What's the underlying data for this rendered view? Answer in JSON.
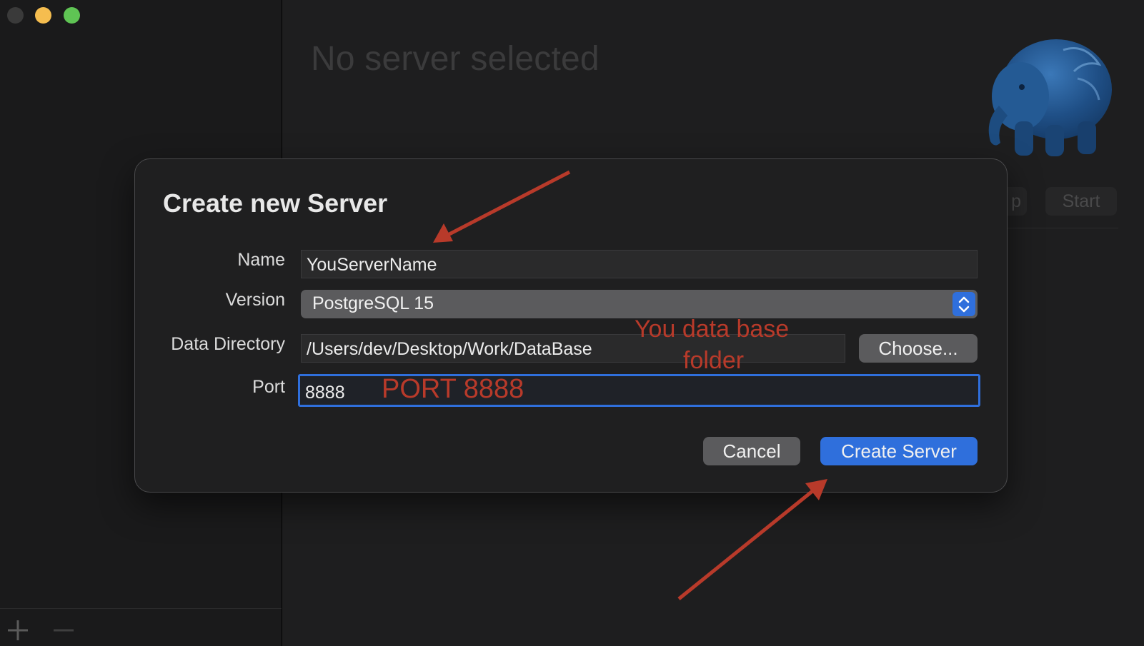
{
  "colors": {
    "accent": "#2f6fdc",
    "annotation": "#b83a2a",
    "close": "#3a3a3a",
    "minimize": "#f5bd4f",
    "zoom": "#5fc454"
  },
  "main": {
    "title": "No server selected",
    "start_label": "Start",
    "clipped_label": "p"
  },
  "dialog": {
    "title": "Create new Server",
    "name_label": "Name",
    "name_value": "YouServerName",
    "version_label": "Version",
    "version_value": "PostgreSQL 15",
    "data_dir_label": "Data Directory",
    "data_dir_value": "/Users/dev/Desktop/Work/DataBase",
    "choose_label": "Choose...",
    "port_label": "Port",
    "port_value": "8888",
    "cancel_label": "Cancel",
    "create_label": "Create Server"
  },
  "annotations": {
    "folder_line1": "You data base",
    "folder_line2": "folder",
    "port_text": "PORT  8888"
  },
  "icons": {
    "add": "plus-icon",
    "remove": "minus-icon",
    "logo": "elephant-icon",
    "stepper": "chevron-up-down-icon"
  }
}
